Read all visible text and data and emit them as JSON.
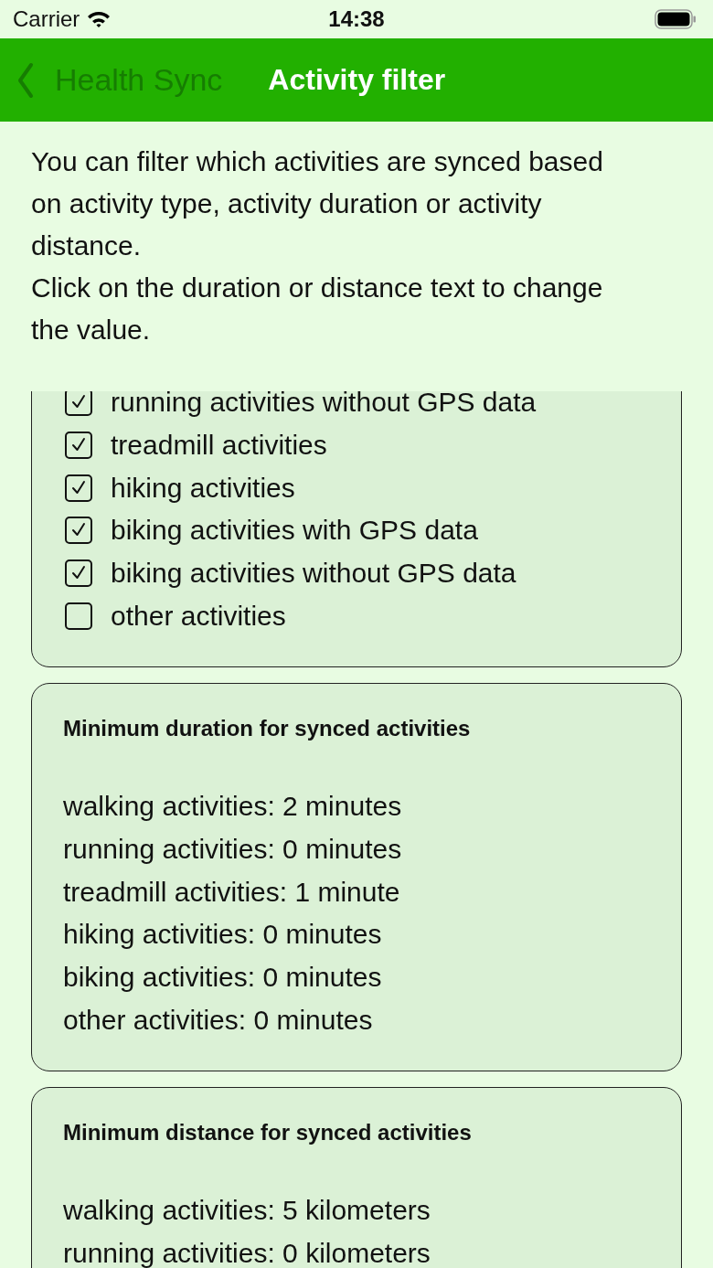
{
  "status_bar": {
    "carrier": "Carrier",
    "time": "14:38"
  },
  "nav": {
    "back": "Health Sync",
    "title": "Activity filter"
  },
  "intro": [
    "You can filter which activities are synced based on activity type, activity duration or activity distance.",
    "Click on the duration or distance text to change the value."
  ],
  "sections": [
    {
      "kind": "checklist",
      "items": [
        {
          "label": "running activities without GPS data",
          "checked": true
        },
        {
          "label": "treadmill activities",
          "checked": true
        },
        {
          "label": "hiking activities",
          "checked": true
        },
        {
          "label": "biking activities with GPS data",
          "checked": true
        },
        {
          "label": "biking activities without GPS data",
          "checked": true
        },
        {
          "label": "other activities",
          "checked": false
        }
      ]
    },
    {
      "kind": "values",
      "title": "Minimum duration for synced activities",
      "lines": [
        "walking activities: 2 minutes",
        "running activities: 0 minutes",
        "treadmill activities: 1 minute",
        "hiking activities: 0 minutes",
        "biking activities: 0 minutes",
        "other activities: 0 minutes"
      ]
    },
    {
      "kind": "values",
      "title": "Minimum distance for synced activities",
      "lines": [
        "walking activities: 5 kilometers",
        "running activities: 0 kilometers"
      ]
    }
  ]
}
